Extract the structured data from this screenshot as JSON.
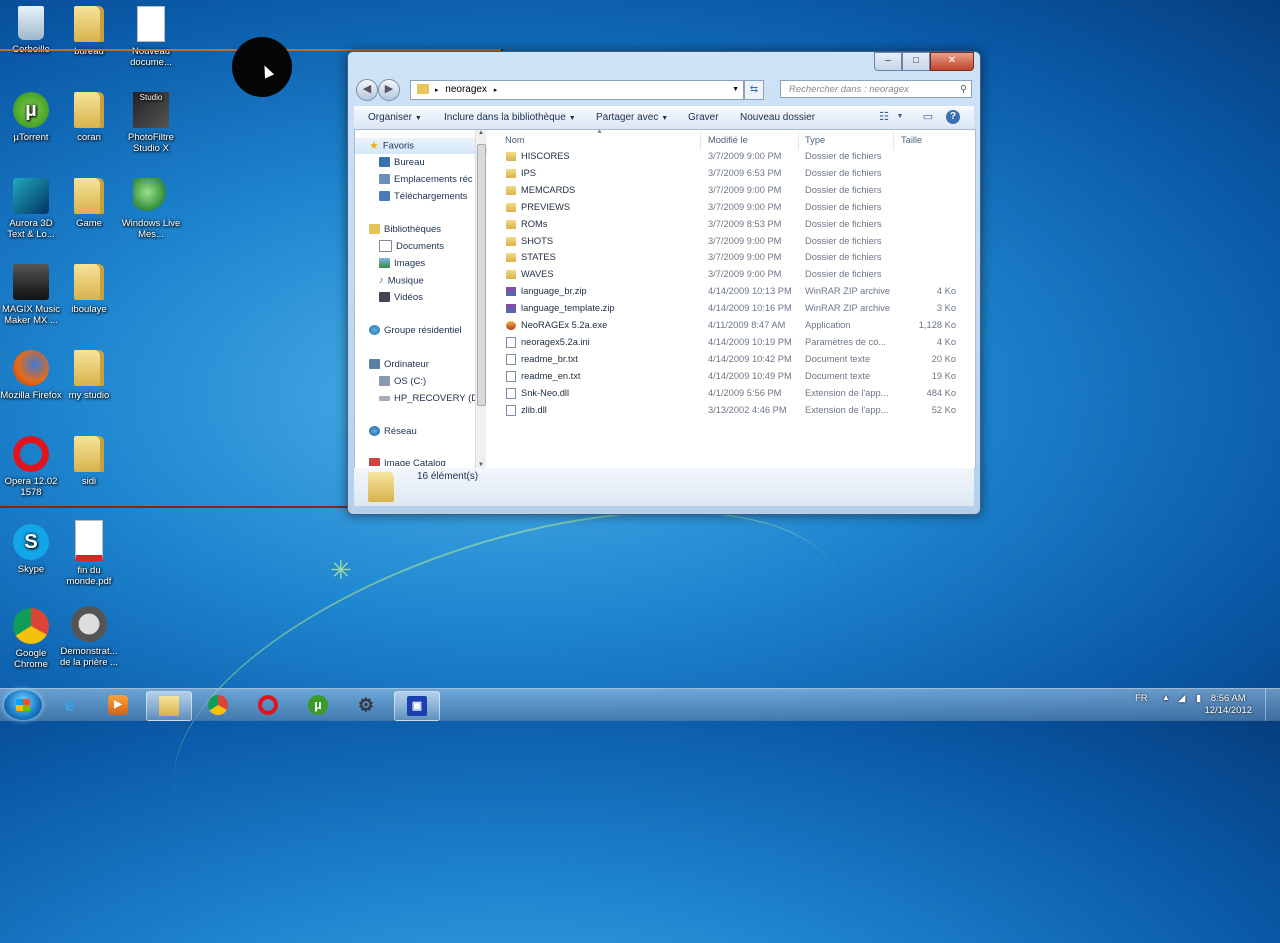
{
  "desktop": {
    "icons": [
      {
        "label": "Corbeille"
      },
      {
        "label": "bureau"
      },
      {
        "label": "Nouveau docume..."
      },
      {
        "label": "µTorrent"
      },
      {
        "label": "coran"
      },
      {
        "label": "PhotoFiltre Studio X"
      },
      {
        "label": "Aurora 3D Text & Lo..."
      },
      {
        "label": "Game"
      },
      {
        "label": "Windows Live Mes..."
      },
      {
        "label": "MAGIX Music Maker MX ..."
      },
      {
        "label": "iboulaye"
      },
      {
        "label": "Mozilla Firefox"
      },
      {
        "label": "my studio"
      },
      {
        "label": "Opera 12.02 1578"
      },
      {
        "label": "sidi"
      },
      {
        "label": "Skype"
      },
      {
        "label": "fin du monde.pdf"
      },
      {
        "label": "Google Chrome"
      },
      {
        "label": "Demonstrat... de la prière ..."
      }
    ],
    "studio_badge": "Studio"
  },
  "window": {
    "address": {
      "crumb": "neoragex"
    },
    "search_placeholder": "Rechercher dans : neoragex",
    "toolbar": {
      "organiser": "Organiser",
      "inclure": "Inclure dans la bibliothèque",
      "partager": "Partager avec",
      "graver": "Graver",
      "nouveau_dossier": "Nouveau dossier"
    },
    "nav": {
      "favoris": "Favoris",
      "bureau": "Bureau",
      "emplacements": "Emplacements réc",
      "telechargements": "Téléchargements",
      "bibliotheques": "Bibliothèques",
      "documents": "Documents",
      "images": "Images",
      "musique": "Musique",
      "videos": "Vidéos",
      "groupe": "Groupe résidentiel",
      "ordinateur": "Ordinateur",
      "os": "OS (C:)",
      "hp": "HP_RECOVERY (D:",
      "reseau": "Réseau",
      "cut": "Image Catalog"
    },
    "columns": {
      "nom": "Nom",
      "modifie": "Modifié le",
      "type": "Type",
      "taille": "Taille"
    },
    "files": [
      {
        "name": "HISCORES",
        "date": "3/7/2009 9:00 PM",
        "type": "Dossier de fichiers",
        "size": "",
        "kind": "folder"
      },
      {
        "name": "IPS",
        "date": "3/7/2009 6:53 PM",
        "type": "Dossier de fichiers",
        "size": "",
        "kind": "folder"
      },
      {
        "name": "MEMCARDS",
        "date": "3/7/2009 9:00 PM",
        "type": "Dossier de fichiers",
        "size": "",
        "kind": "folder"
      },
      {
        "name": "PREVIEWS",
        "date": "3/7/2009 9:00 PM",
        "type": "Dossier de fichiers",
        "size": "",
        "kind": "folder"
      },
      {
        "name": "ROMs",
        "date": "3/7/2009 8:53 PM",
        "type": "Dossier de fichiers",
        "size": "",
        "kind": "folder"
      },
      {
        "name": "SHOTS",
        "date": "3/7/2009 9:00 PM",
        "type": "Dossier de fichiers",
        "size": "",
        "kind": "folder"
      },
      {
        "name": "STATES",
        "date": "3/7/2009 9:00 PM",
        "type": "Dossier de fichiers",
        "size": "",
        "kind": "folder"
      },
      {
        "name": "WAVES",
        "date": "3/7/2009 9:00 PM",
        "type": "Dossier de fichiers",
        "size": "",
        "kind": "folder"
      },
      {
        "name": "language_br.zip",
        "date": "4/14/2009 10:13 PM",
        "type": "WinRAR ZIP archive",
        "size": "4 Ko",
        "kind": "zip"
      },
      {
        "name": "language_template.zip",
        "date": "4/14/2009 10:16 PM",
        "type": "WinRAR ZIP archive",
        "size": "3 Ko",
        "kind": "zip"
      },
      {
        "name": "NeoRAGEx 5.2a.exe",
        "date": "4/11/2009 8:47 AM",
        "type": "Application",
        "size": "1,128 Ko",
        "kind": "exe"
      },
      {
        "name": "neoragex5.2a.ini",
        "date": "4/14/2009 10:19 PM",
        "type": "Paramètres de co...",
        "size": "4 Ko",
        "kind": "doc"
      },
      {
        "name": "readme_br.txt",
        "date": "4/14/2009 10:42 PM",
        "type": "Document texte",
        "size": "20 Ko",
        "kind": "doc"
      },
      {
        "name": "readme_en.txt",
        "date": "4/14/2009 10:49 PM",
        "type": "Document texte",
        "size": "19 Ko",
        "kind": "doc"
      },
      {
        "name": "Snk-Neo.dll",
        "date": "4/1/2009 5:56 PM",
        "type": "Extension de l'app...",
        "size": "484 Ko",
        "kind": "doc"
      },
      {
        "name": "zlib.dll",
        "date": "3/13/2002 4:46 PM",
        "type": "Extension de l'app...",
        "size": "52 Ko",
        "kind": "doc"
      }
    ],
    "status": "16 élément(s)"
  },
  "taskbar": {
    "lang": "FR",
    "time": "8:56 AM",
    "date": "12/14/2012"
  }
}
